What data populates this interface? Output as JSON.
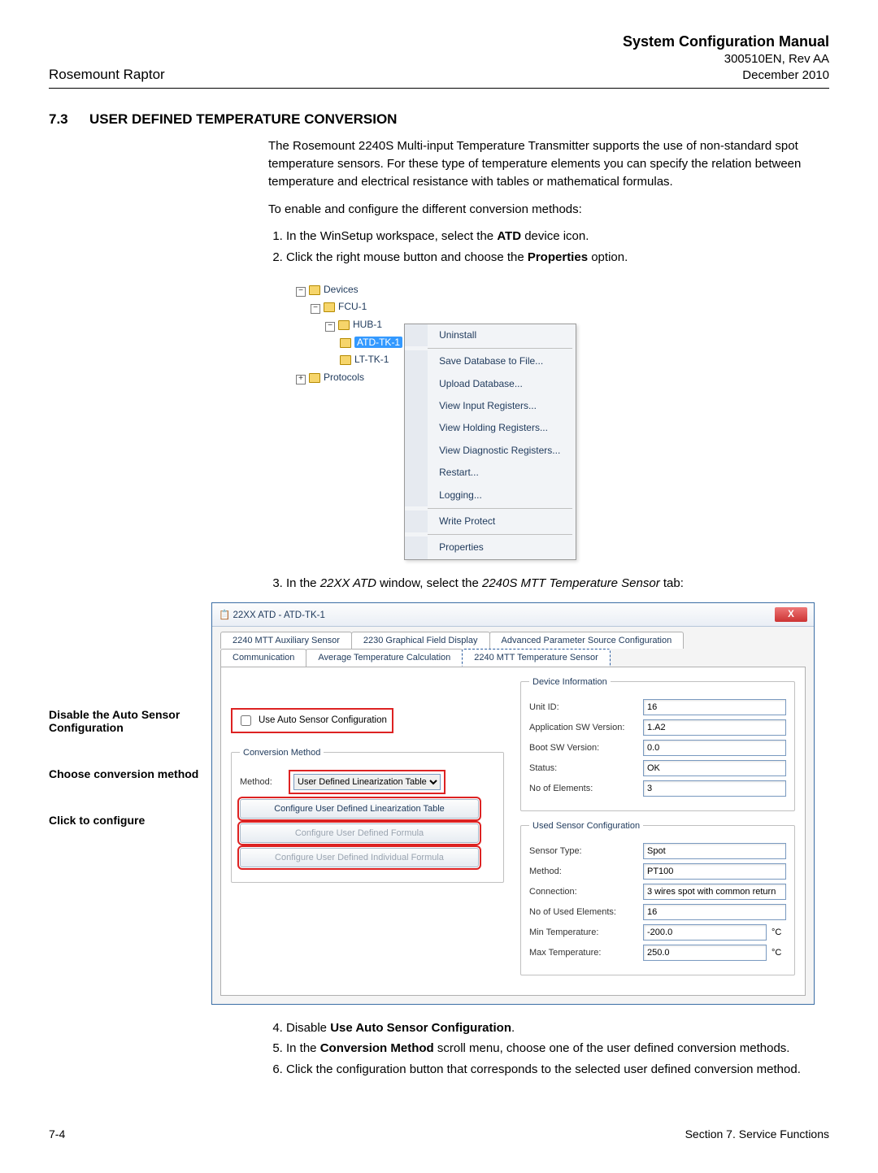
{
  "header": {
    "product": "Rosemount Raptor",
    "manual_title": "System Configuration Manual",
    "docnum": "300510EN, Rev AA",
    "date": "December 2010"
  },
  "section": {
    "num": "7.3",
    "title": "USER DEFINED TEMPERATURE CONVERSION"
  },
  "body": {
    "p1": "The Rosemount 2240S Multi-input Temperature Transmitter supports the use of non-standard spot temperature sensors. For these type of temperature elements you can specify the relation between temperature and electrical resistance with tables or mathematical formulas.",
    "p2": "To enable and configure the different conversion methods:",
    "step1_pre": "In the WinSetup workspace, select the ",
    "step1_strong": "ATD",
    "step1_post": " device icon.",
    "step2_pre": "Click the right mouse button and choose the ",
    "step2_strong": "Properties",
    "step2_post": " option.",
    "step3_pre": "In the ",
    "step3_em": "22XX ATD",
    "step3_mid": " window, select the ",
    "step3_em2": "2240S MTT Temperature Sensor",
    "step3_post": " tab:",
    "step4_pre": "Disable ",
    "step4_strong": "Use Auto Sensor Configuration",
    "step4_post": ".",
    "step5_pre": "In the ",
    "step5_strong": "Conversion Method",
    "step5_post": " scroll menu, choose one of the user defined conversion methods.",
    "step6": "Click the configuration button that corresponds to the selected user defined conversion method."
  },
  "tree": {
    "devices": "Devices",
    "fcu": "FCU-1",
    "hub": "HUB-1",
    "atd": "ATD-TK-1",
    "lt": "LT-TK-1",
    "protocols": "Protocols"
  },
  "context_menu": {
    "items": [
      "Uninstall",
      "Save Database to File...",
      "Upload Database...",
      "View Input Registers...",
      "View Holding Registers...",
      "View Diagnostic Registers...",
      "Restart...",
      "Logging...",
      "Write Protect",
      "Properties"
    ]
  },
  "callouts": {
    "c1": "Disable the Auto Sensor Configuration",
    "c2": "Choose conversion method",
    "c3": "Click to configure"
  },
  "dialog": {
    "title": "22XX ATD  - ATD-TK-1",
    "tabs": {
      "t1": "2240 MTT Auxiliary Sensor",
      "t2": "2230 Graphical Field Display",
      "t3": "Advanced Parameter Source Configuration",
      "t4": "Communication",
      "t5": "Average Temperature Calculation",
      "t6": "2240 MTT Temperature Sensor"
    },
    "auto_chk_label": "Use Auto Sensor Configuration",
    "conv_legend": "Conversion Method",
    "conv_method_label": "Method:",
    "conv_method_value": "User Defined Linearization Table",
    "btn_lin": "Configure User Defined Linearization Table",
    "btn_formula": "Configure User Defined Formula",
    "btn_indiv": "Configure User Defined Individual Formula",
    "dev_legend": "Device Information",
    "dev": {
      "unit_id_l": "Unit ID:",
      "unit_id_v": "16",
      "appsw_l": "Application SW Version:",
      "appsw_v": "1.A2",
      "boot_l": "Boot SW Version:",
      "boot_v": "0.0",
      "status_l": "Status:",
      "status_v": "OK",
      "noel_l": "No of Elements:",
      "noel_v": "3"
    },
    "used_legend": "Used Sensor Configuration",
    "used": {
      "sensor_type_l": "Sensor Type:",
      "sensor_type_v": "Spot",
      "method_l": "Method:",
      "method_v": "PT100",
      "conn_l": "Connection:",
      "conn_v": "3 wires spot with common return",
      "noused_l": "No of Used Elements:",
      "noused_v": "16",
      "min_l": "Min Temperature:",
      "min_v": "-200.0",
      "max_l": "Max Temperature:",
      "max_v": "250.0",
      "unit": "°C"
    }
  },
  "footer": {
    "page": "7-4",
    "section": "Section 7. Service Functions"
  }
}
